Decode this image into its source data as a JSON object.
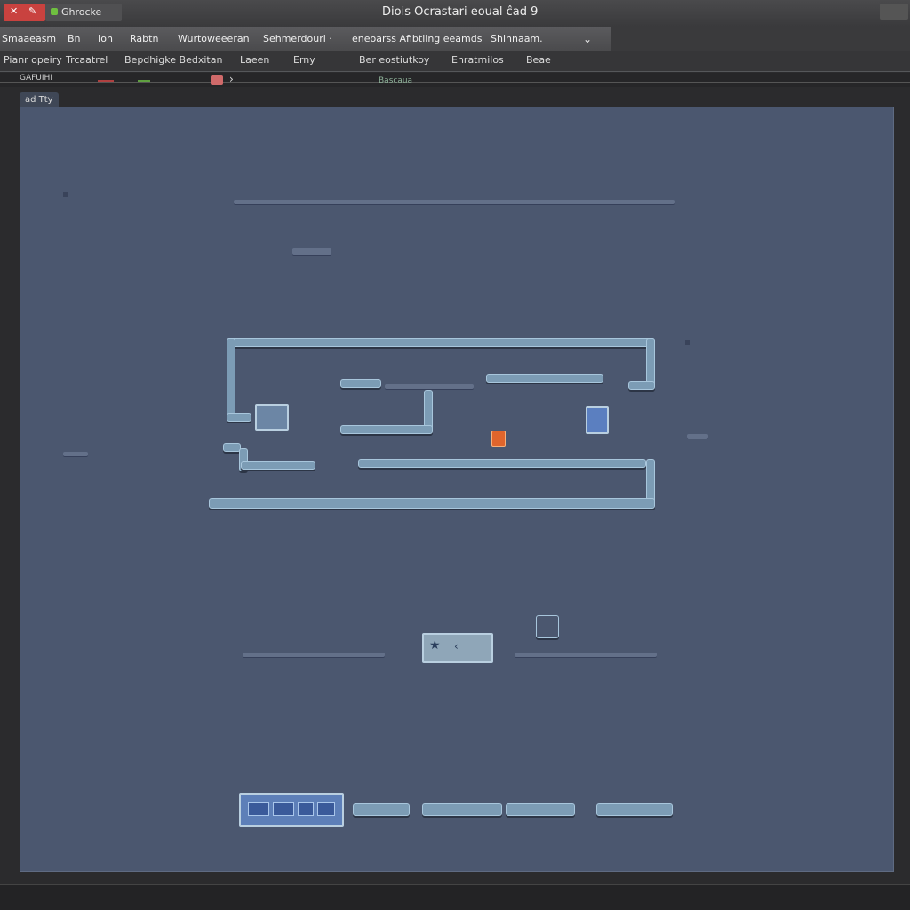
{
  "window": {
    "title": "Diois Ocrastari eoual ĉad 9"
  },
  "tabs": {
    "active_label": "Ghrocke"
  },
  "menu": [
    {
      "label": "Smaaeasm"
    },
    {
      "label": "Bn"
    },
    {
      "label": "Ion"
    },
    {
      "label": "Rabtn"
    },
    {
      "label": "Wurtoweeeran"
    },
    {
      "label": "Sehmerdourl ·"
    },
    {
      "label": "eneoarss Afibtiing eeamds"
    },
    {
      "label": "Shihnaam."
    }
  ],
  "toolbar": [
    {
      "label": "Pianr opeiry"
    },
    {
      "label": "Trcaatrel"
    },
    {
      "label": "Bepdhigke Bedxitan"
    },
    {
      "label": "Laeen"
    },
    {
      "label": "Erny"
    },
    {
      "label": "Ber eostiutkoy"
    },
    {
      "label": "Ehratmilos"
    },
    {
      "label": "Beae"
    }
  ],
  "ruler": {
    "left_label": "GAFUIHI",
    "center_label": "Bascaua"
  },
  "document": {
    "tab_label": "ad Tty"
  },
  "colors": {
    "canvas": "#4b576f",
    "wall": "#7c9cb5",
    "accent": "#c9423f",
    "player": "#e0652c"
  }
}
